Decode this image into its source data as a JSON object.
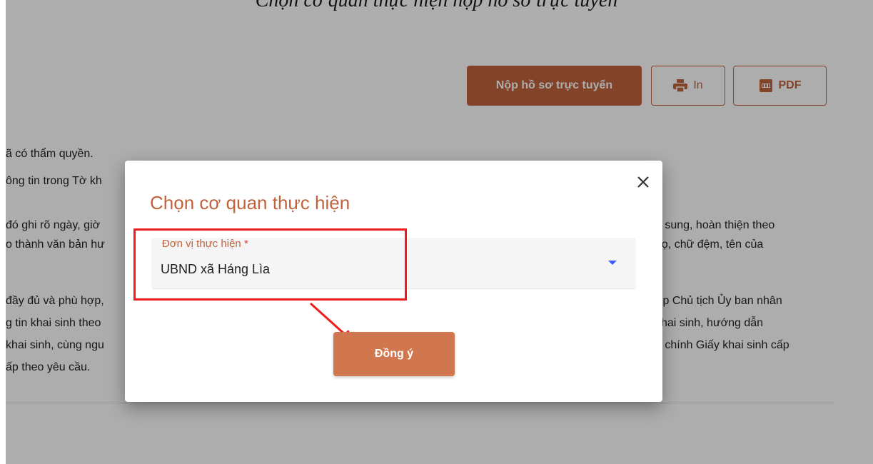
{
  "caption": {
    "text": "Chọn cơ quan thực hiện nộp hồ sơ trực tuyến"
  },
  "toolbar": {
    "submit_label": "Nộp hồ sơ trực tuyến",
    "print_label": "In",
    "pdf_label": "PDF"
  },
  "background_text": {
    "left_lines": [
      "ã có thẩm quyền.",
      "ông tin trong Tờ kh",
      " đó ghi rõ ngày, giờ",
      "o thành văn bản hư",
      "đầy đủ và phù hợp,",
      "g tin khai sinh theo",
      "khai sinh, cùng ngu",
      "ấp theo yêu cầu."
    ],
    "right_lines": [
      "ổ sung, hoàn thiện theo",
      "họ, chữ đệm, tên của",
      "ợp Chủ tịch Ủy ban nhân",
      "khai sinh, hướng dẫn",
      "n chính Giấy khai sinh cấp"
    ]
  },
  "modal": {
    "title": "Chọn cơ quan thực hiện",
    "field_label": "Đơn vị thực hiện",
    "required_mark": "*",
    "selected_value": "UBND xã Háng Lìa",
    "confirm_label": "Đồng ý"
  },
  "colors": {
    "accent": "#c0633d",
    "confirm": "#d1774f",
    "annotation": "#ee1c1c",
    "caret": "#3d5afe"
  },
  "icons": {
    "print": "printer-icon",
    "pdf": "pdf-file-icon",
    "close": "close-icon",
    "dropdown": "caret-down-icon"
  }
}
